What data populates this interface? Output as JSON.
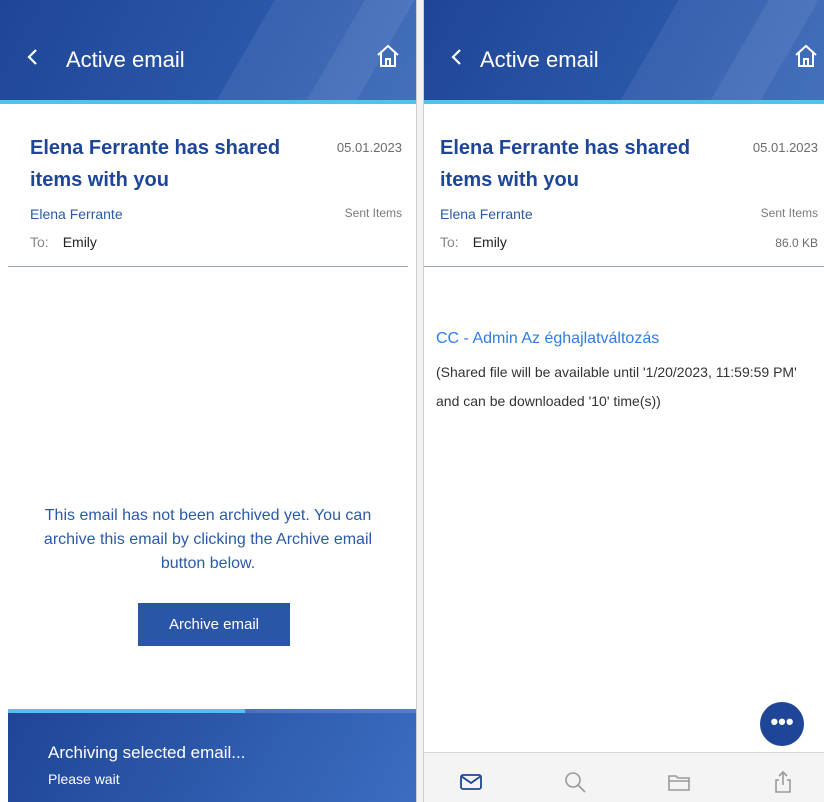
{
  "left": {
    "header": {
      "title": "Active email"
    },
    "email": {
      "subject": "Elena Ferrante has shared items with you",
      "date": "05.01.2023",
      "sender": "Elena Ferrante",
      "folder": "Sent Items",
      "to_label": "To:",
      "to_value": "Emily"
    },
    "archive_notice": "This email has not been archived yet. You can archive this email by clicking the Archive email button below.",
    "archive_button": "Archive email",
    "toast": {
      "title": "Archiving selected email...",
      "subtitle": "Please wait",
      "progress": 0.58
    }
  },
  "right": {
    "header": {
      "title": "Active email"
    },
    "email": {
      "subject": "Elena Ferrante has shared items with you",
      "date": "05.01.2023",
      "sender": "Elena Ferrante",
      "folder": "Sent Items",
      "to_label": "To:",
      "to_value": "Emily",
      "size": "86.0 KB"
    },
    "attachment_link": "CC - Admin Az éghajlatváltozás",
    "attachment_info": "(Shared file will be available until '1/20/2023, 11:59:59 PM' and can be downloaded '10' time(s))",
    "fab_label": "•••",
    "tabs": [
      "mail-icon",
      "search-icon",
      "folder-icon",
      "share-icon"
    ]
  },
  "colors": {
    "header": "#1f4596",
    "accent": "#4fc3e8",
    "link": "#2f7de1",
    "text_blue": "#2a5aa8"
  }
}
